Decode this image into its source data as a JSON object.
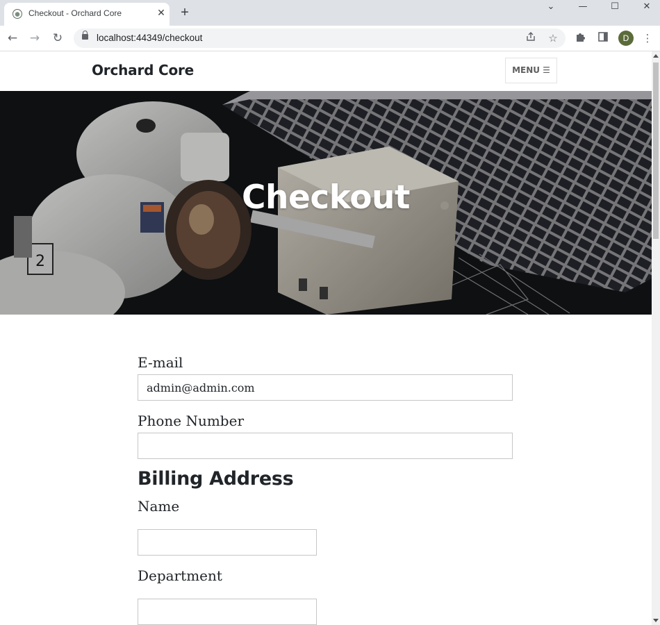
{
  "browser": {
    "tab_title": "Checkout - Orchard Core",
    "tab_close": "✕",
    "new_tab": "+",
    "url": "localhost:44349/checkout",
    "profile_initial": "D",
    "window_controls": {
      "dropdown": "⌄",
      "minimize": "—",
      "maximize": "☐",
      "close": "✕"
    },
    "nav_icons": {
      "back": "←",
      "forward": "→",
      "reload": "↻"
    }
  },
  "site": {
    "brand": "Orchard Core",
    "menu_label": "MENU ☰"
  },
  "hero": {
    "title": "Checkout"
  },
  "form": {
    "email_label": "E-mail",
    "email_value": "admin@admin.com",
    "phone_label": "Phone Number",
    "phone_value": "",
    "billing_heading": "Billing Address",
    "name_label": "Name",
    "name_value": "",
    "department_label": "Department",
    "department_value": ""
  }
}
